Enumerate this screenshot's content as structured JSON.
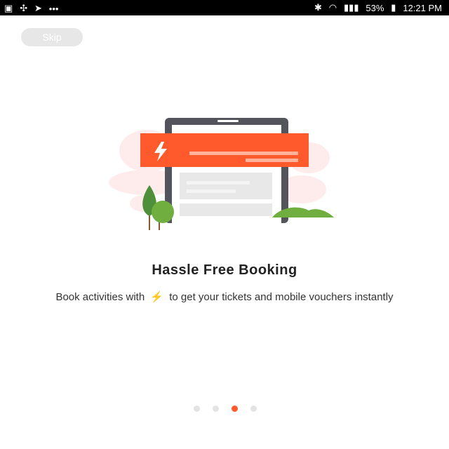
{
  "status_bar": {
    "time": "12:21 PM",
    "battery": "53%",
    "left_icons": [
      "gallery-icon",
      "bluetooth-like-icon",
      "share-icon",
      "more-icon"
    ],
    "right_icons": [
      "bluetooth-icon",
      "wifi-icon",
      "signal-icon",
      "battery-icon"
    ]
  },
  "skip": {
    "label": "Skip"
  },
  "onboarding": {
    "title": "Hassle Free Booking",
    "description_before": "Book activities with",
    "bolt_glyph": "⚡",
    "description_after": "to get your tickets and mobile vouchers instantly"
  },
  "pagination": {
    "total": 4,
    "active_index": 2
  },
  "colors": {
    "accent": "#ff5a2c",
    "phone_frame": "#54545c",
    "tree_green": "#4f8f3a",
    "bg_pink": "#fdeceb"
  }
}
